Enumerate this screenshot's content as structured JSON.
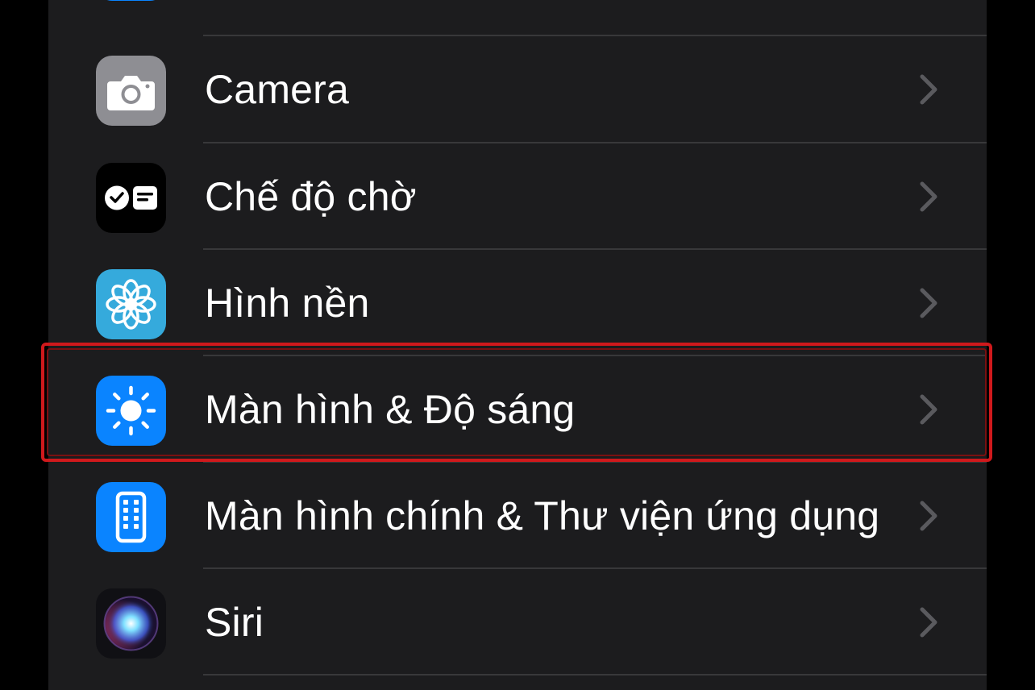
{
  "settings": {
    "items": [
      {
        "label": "Camera",
        "icon": "camera-icon",
        "color": "#8e8e93"
      },
      {
        "label": "Chế độ chờ",
        "icon": "standby-icon",
        "color": "#000000"
      },
      {
        "label": "Hình nền",
        "icon": "wallpaper-icon",
        "color": "#35aadc"
      },
      {
        "label": "Màn hình & Độ sáng",
        "icon": "display-brightness-icon",
        "color": "#0a84ff"
      },
      {
        "label": "Màn hình chính & Thư viện ứng dụng",
        "icon": "home-screen-icon",
        "color": "#0a84ff"
      },
      {
        "label": "Siri",
        "icon": "siri-icon",
        "color": "#1c1c1e"
      }
    ],
    "highlighted_index": 3,
    "highlight_color": "#d0191c"
  }
}
